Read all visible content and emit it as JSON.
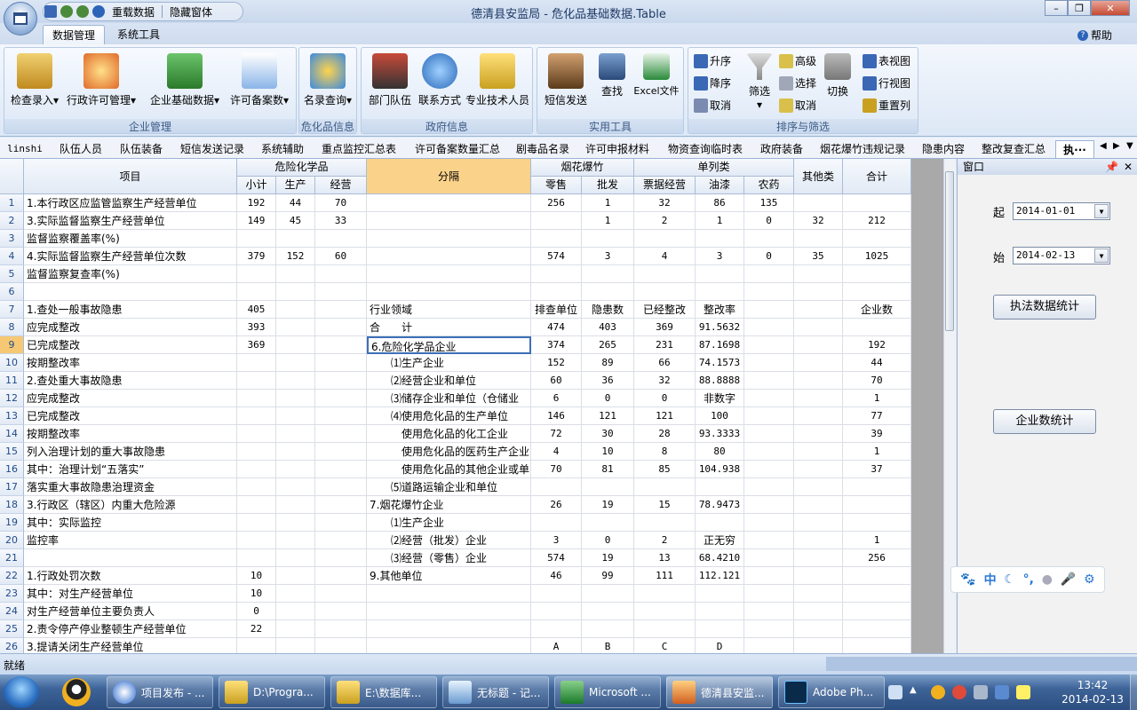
{
  "window": {
    "title": "德清县安监局 - 危化品基础数据.Table",
    "qat": {
      "reload": "重载数据",
      "hide": "隐藏窗体"
    }
  },
  "ribbon_tabs": [
    "数据管理",
    "系统工具"
  ],
  "help": "帮助",
  "ribbon": {
    "group1": {
      "label": "企业管理",
      "buttons": [
        "检查录入",
        "行政许可管理",
        "企业基础数据",
        "许可备案数"
      ]
    },
    "group2": {
      "label": "危化品信息",
      "buttons": [
        "名录查询"
      ]
    },
    "group3": {
      "label": "政府信息",
      "buttons": [
        "部门队伍",
        "联系方式",
        "专业技术人员"
      ]
    },
    "group4": {
      "label": "实用工具",
      "buttons": [
        "短信发送",
        "查找",
        "Excel文件"
      ]
    },
    "group5": {
      "label": "排序与筛选",
      "sort": [
        "升序",
        "降序",
        "取消"
      ],
      "filter": "筛选",
      "adv": [
        "高级",
        "选择",
        "取消"
      ],
      "switch": "切换",
      "views": [
        "表视图",
        "行视图",
        "重置列"
      ]
    }
  },
  "doc_tabs": [
    "linshi",
    "队伍人员",
    "队伍装备",
    "短信发送记录",
    "系统辅助",
    "重点监控汇总表",
    "许可备案数量汇总",
    "剧毒品名录",
    "许可申报材料",
    "物资查询临时表",
    "政府装备",
    "烟花爆竹违规记录",
    "隐患内容",
    "整改复查汇总",
    "执···"
  ],
  "grid": {
    "headers": {
      "item": "项目",
      "hazchem": "危险化学品",
      "sub": [
        "小计",
        "生产",
        "经营"
      ],
      "sep": "分隔",
      "fireworks": "烟花爆竹",
      "fw_sub": [
        "零售",
        "批发"
      ],
      "single": "单列类",
      "single_sub": [
        "票据经营",
        "油漆",
        "农药"
      ],
      "other": "其他类",
      "total": "合计"
    },
    "rows": [
      [
        "1",
        "1.本行政区应监管监察生产经营单位",
        "192",
        "44",
        "70",
        "",
        "256",
        "1",
        "32",
        "86",
        "135",
        "",
        ""
      ],
      [
        "2",
        "3.实际监督监察生产经营单位",
        "149",
        "45",
        "33",
        "",
        "",
        "1",
        "2",
        "1",
        "0",
        "32",
        "212"
      ],
      [
        "3",
        "监督监察覆盖率(%)",
        "",
        "",
        "",
        "",
        "",
        "",
        "",
        "",
        "",
        "",
        ""
      ],
      [
        "4",
        "4.实际监督监察生产经营单位次数",
        "379",
        "152",
        "60",
        "",
        "574",
        "3",
        "4",
        "3",
        "0",
        "35",
        "1025"
      ],
      [
        "5",
        "监督监察复查率(%)",
        "",
        "",
        "",
        "",
        "",
        "",
        "",
        "",
        "",
        "",
        ""
      ],
      [
        "6",
        "",
        "",
        "",
        "",
        "",
        "",
        "",
        "",
        "",
        "",
        "",
        ""
      ],
      [
        "7",
        "1.查处一般事故隐患",
        "405",
        "",
        "",
        "行业领域",
        "排查单位",
        "隐患数",
        "已经整改",
        "整改率",
        "",
        "",
        "企业数"
      ],
      [
        "8",
        "应完成整改",
        "393",
        "",
        "",
        "合　　计",
        "474",
        "403",
        "369",
        "91.5632",
        "",
        "",
        ""
      ],
      [
        "9",
        "已完成整改",
        "369",
        "",
        "",
        "6.危险化学品企业",
        "374",
        "265",
        "231",
        "87.1698",
        "",
        "",
        "192"
      ],
      [
        "10",
        "按期整改率",
        "",
        "",
        "",
        "　　⑴生产企业",
        "152",
        "89",
        "66",
        "74.1573",
        "",
        "",
        "44"
      ],
      [
        "11",
        "2.查处重大事故隐患",
        "",
        "",
        "",
        "　　⑵经营企业和单位",
        "60",
        "36",
        "32",
        "88.8888",
        "",
        "",
        "70"
      ],
      [
        "12",
        "应完成整改",
        "",
        "",
        "",
        "　　⑶储存企业和单位（仓储业",
        "6",
        "0",
        "0",
        "非数字",
        "",
        "",
        "1"
      ],
      [
        "13",
        "已完成整改",
        "",
        "",
        "",
        "　　⑷使用危化品的生产单位",
        "146",
        "121",
        "121",
        "100",
        "",
        "",
        "77"
      ],
      [
        "14",
        "按期整改率",
        "",
        "",
        "",
        "　　　使用危化品的化工企业",
        "72",
        "30",
        "28",
        "93.3333",
        "",
        "",
        "39"
      ],
      [
        "15",
        "列入治理计划的重大事故隐患",
        "",
        "",
        "",
        "　　　使用危化品的医药生产企业",
        "4",
        "10",
        "8",
        "80",
        "",
        "",
        "1"
      ],
      [
        "16",
        "其中：治理计划“五落实”",
        "",
        "",
        "",
        "　　　使用危化品的其他企业或单",
        "70",
        "81",
        "85",
        "104.938",
        "",
        "",
        "37"
      ],
      [
        "17",
        "落实重大事故隐患治理资金",
        "",
        "",
        "",
        "　　⑸道路运输企业和单位",
        "",
        "",
        "",
        "",
        "",
        "",
        ""
      ],
      [
        "18",
        "3.行政区（辖区）内重大危险源",
        "",
        "",
        "",
        "7.烟花爆竹企业",
        "26",
        "19",
        "15",
        "78.9473",
        "",
        "",
        ""
      ],
      [
        "19",
        "其中：实际监控",
        "",
        "",
        "",
        "　　⑴生产企业",
        "",
        "",
        "",
        "",
        "",
        "",
        ""
      ],
      [
        "20",
        "监控率",
        "",
        "",
        "",
        "　　⑵经营（批发）企业",
        "3",
        "0",
        "2",
        "正无穷",
        "",
        "",
        "1"
      ],
      [
        "21",
        "",
        "",
        "",
        "",
        "　　⑶经营（零售）企业",
        "574",
        "19",
        "13",
        "68.4210",
        "",
        "",
        "256"
      ],
      [
        "22",
        "1.行政处罚次数",
        "10",
        "",
        "",
        "9.其他单位",
        "46",
        "99",
        "111",
        "112.121",
        "",
        "",
        ""
      ],
      [
        "23",
        "其中：对生产经营单位",
        "10",
        "",
        "",
        "",
        "",
        "",
        "",
        "",
        "",
        "",
        ""
      ],
      [
        "24",
        "对生产经营单位主要负责人",
        "0",
        "",
        "",
        "",
        "",
        "",
        "",
        "",
        "",
        "",
        ""
      ],
      [
        "25",
        "2.责令停产停业整顿生产经营单位",
        "22",
        "",
        "",
        "",
        "",
        "",
        "",
        "",
        "",
        "",
        ""
      ],
      [
        "26",
        "3.提请关闭生产经营单位",
        "",
        "",
        "",
        "",
        "A",
        "B",
        "C",
        "D",
        "",
        "",
        ""
      ]
    ]
  },
  "side_panel": {
    "title": "窗口",
    "from_label": "起",
    "from_date": "2014-01-01",
    "to_label": "始",
    "to_date": "2014-02-13",
    "btn1": "执法数据统计",
    "btn2": "企业数统计"
  },
  "status": "就绪",
  "taskbar": {
    "items": [
      "项目发布 - ...",
      "D:\\Progra...",
      "E:\\数据库...",
      "无标题 - 记...",
      "Microsoft ...",
      "德清县安监...",
      "Adobe Ph..."
    ],
    "time": "13:42",
    "date": "2014-02-13"
  }
}
